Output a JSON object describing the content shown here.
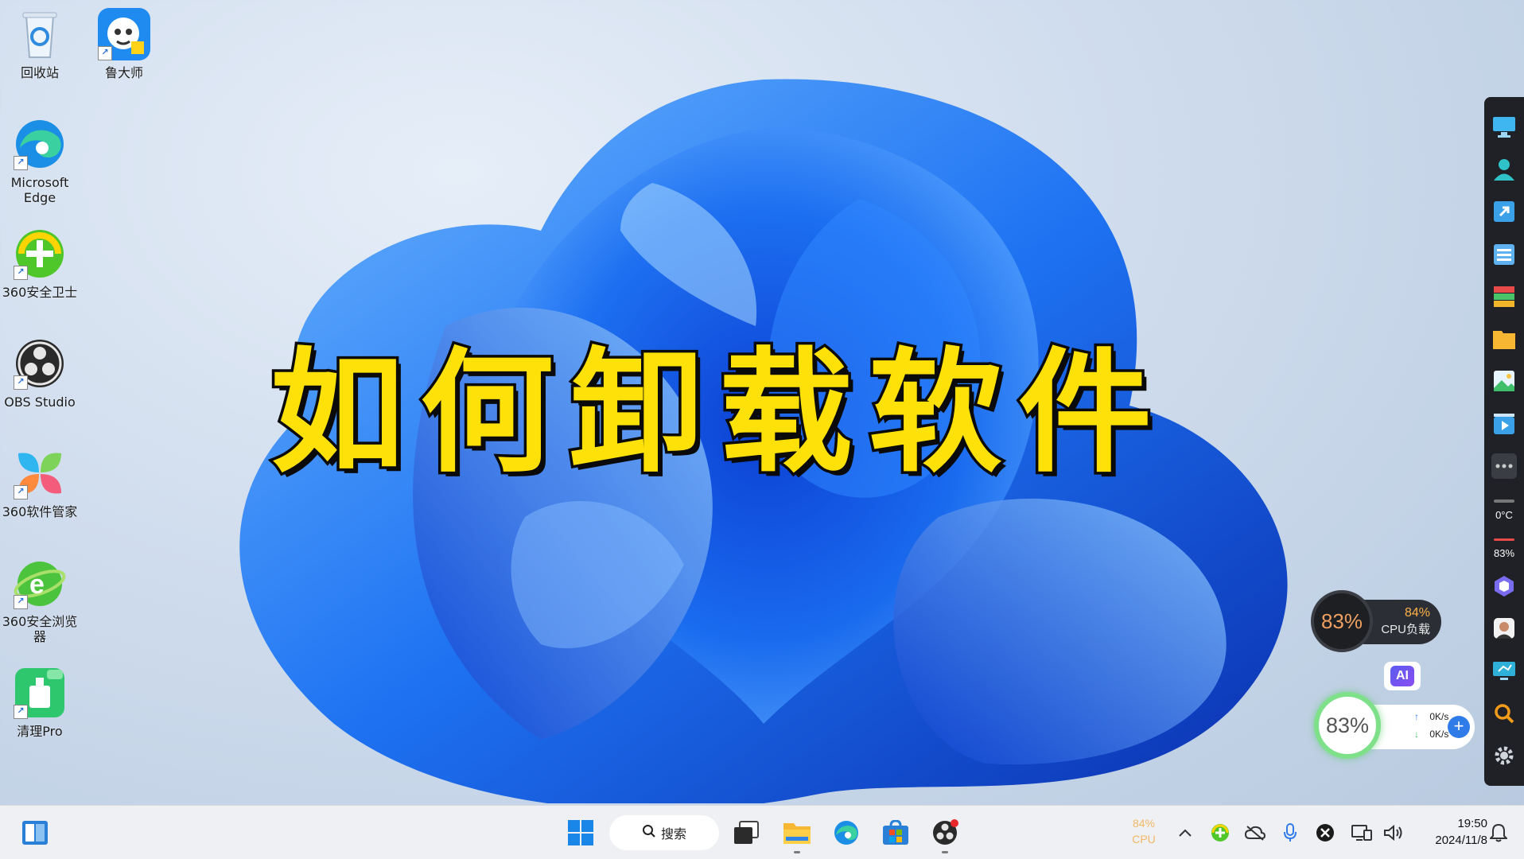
{
  "desktop": {
    "icons": [
      {
        "label": "回收站",
        "icon": "recycle-bin-icon"
      },
      {
        "label": "鲁大师",
        "icon": "ludashi-icon"
      },
      {
        "label": "Microsoft Edge",
        "icon": "edge-icon"
      },
      {
        "label": "360安全卫士",
        "icon": "360-security-icon"
      },
      {
        "label": "OBS Studio",
        "icon": "obs-icon"
      },
      {
        "label": "360软件管家",
        "icon": "360-software-manager-icon"
      },
      {
        "label": "360安全浏览器",
        "icon": "360-browser-icon"
      },
      {
        "label": "清理Pro",
        "icon": "cleaner-pro-icon"
      }
    ]
  },
  "overlay": {
    "title": "如何卸载软件",
    "title_color": "#ffe10a"
  },
  "sidebar": {
    "temp": "0°C",
    "percent": "83%"
  },
  "widgets": {
    "cpu_ring_value": "83%",
    "cpu_load_pct": "84%",
    "cpu_load_label": "CPU负载",
    "ai_label": "AI",
    "mem_ring_value": "83%",
    "net_up": "0K/s",
    "net_down": "0K/s"
  },
  "taskbar": {
    "search_label": "搜索",
    "tray_cpu_pct": "84%",
    "tray_cpu_label": "CPU",
    "time": "19:50",
    "date": "2024/11/8"
  },
  "colors": {
    "accent": "#0f6fe0",
    "taskbar_bg": "#eef0f4",
    "sidebar_bg": "#1f2126"
  }
}
